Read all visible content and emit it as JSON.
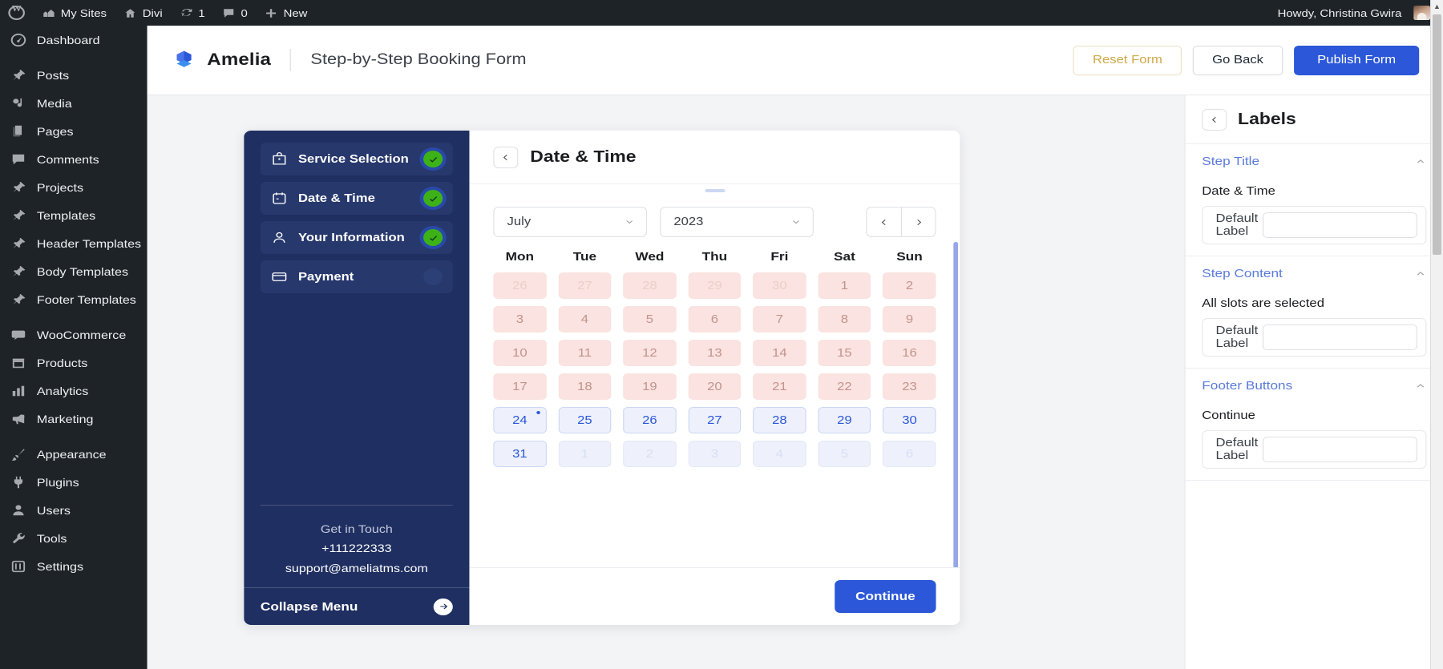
{
  "adminbar": {
    "items": [
      {
        "icon": "wordpress-logo-icon",
        "label": ""
      },
      {
        "icon": "sites-icon",
        "label": "My Sites"
      },
      {
        "icon": "home-icon",
        "label": "Divi"
      },
      {
        "icon": "updates-icon",
        "label": "1"
      },
      {
        "icon": "comment-icon",
        "label": "0"
      },
      {
        "icon": "plus-icon",
        "label": "New"
      }
    ],
    "howdy": "Howdy, Christina Gwira"
  },
  "adminmenu": {
    "items": [
      {
        "label": "Dashboard",
        "icon": "dashboard-icon"
      },
      {
        "label": "Posts",
        "icon": "pin-icon"
      },
      {
        "label": "Media",
        "icon": "media-icon"
      },
      {
        "label": "Pages",
        "icon": "pages-icon"
      },
      {
        "label": "Comments",
        "icon": "comment-icon"
      },
      {
        "label": "Projects",
        "icon": "pin-icon"
      },
      {
        "label": "Templates",
        "icon": "pin-icon"
      },
      {
        "label": "Header Templates",
        "icon": "pin-icon"
      },
      {
        "label": "Body Templates",
        "icon": "pin-icon"
      },
      {
        "label": "Footer Templates",
        "icon": "pin-icon"
      },
      {
        "label": "WooCommerce",
        "icon": "woocommerce-icon"
      },
      {
        "label": "Products",
        "icon": "products-icon"
      },
      {
        "label": "Analytics",
        "icon": "analytics-icon"
      },
      {
        "label": "Marketing",
        "icon": "megaphone-icon"
      },
      {
        "label": "Appearance",
        "icon": "brush-icon"
      },
      {
        "label": "Plugins",
        "icon": "plug-icon"
      },
      {
        "label": "Users",
        "icon": "user-icon"
      },
      {
        "label": "Tools",
        "icon": "wrench-icon"
      },
      {
        "label": "Settings",
        "icon": "settings-icon"
      }
    ]
  },
  "header": {
    "brand": "Amelia",
    "page_title": "Step-by-Step Booking Form",
    "reset_label": "Reset Form",
    "goback_label": "Go Back",
    "publish_label": "Publish Form",
    "accent": "#2b57d8",
    "reset_color": "#cfa847"
  },
  "booking": {
    "steps": [
      {
        "label": "Service Selection",
        "icon": "bag-icon",
        "state": "complete"
      },
      {
        "label": "Date & Time",
        "icon": "calendar-icon",
        "state": "complete"
      },
      {
        "label": "Your Information",
        "icon": "person-icon",
        "state": "complete"
      },
      {
        "label": "Payment",
        "icon": "card-icon",
        "state": "pending"
      }
    ],
    "contact": {
      "title": "Get in Touch",
      "phone": "+111222333",
      "email": "support@ameliatms.com"
    },
    "collapse_label": "Collapse Menu",
    "step_title": "Date & Time",
    "month": "July",
    "year": "2023",
    "weekdays": [
      "Mon",
      "Tue",
      "Wed",
      "Thu",
      "Fri",
      "Sat",
      "Sun"
    ],
    "weeks": [
      [
        {
          "d": "26",
          "state": "busy",
          "outside": true
        },
        {
          "d": "27",
          "state": "busy",
          "outside": true
        },
        {
          "d": "28",
          "state": "busy",
          "outside": true
        },
        {
          "d": "29",
          "state": "busy",
          "outside": true
        },
        {
          "d": "30",
          "state": "busy",
          "outside": true
        },
        {
          "d": "1",
          "state": "busy",
          "outside": false
        },
        {
          "d": "2",
          "state": "busy",
          "outside": false
        }
      ],
      [
        {
          "d": "3",
          "state": "busy",
          "outside": false
        },
        {
          "d": "4",
          "state": "busy",
          "outside": false
        },
        {
          "d": "5",
          "state": "busy",
          "outside": false
        },
        {
          "d": "6",
          "state": "busy",
          "outside": false
        },
        {
          "d": "7",
          "state": "busy",
          "outside": false
        },
        {
          "d": "8",
          "state": "busy",
          "outside": false
        },
        {
          "d": "9",
          "state": "busy",
          "outside": false
        }
      ],
      [
        {
          "d": "10",
          "state": "busy",
          "outside": false
        },
        {
          "d": "11",
          "state": "busy",
          "outside": false
        },
        {
          "d": "12",
          "state": "busy",
          "outside": false
        },
        {
          "d": "13",
          "state": "busy",
          "outside": false
        },
        {
          "d": "14",
          "state": "busy",
          "outside": false
        },
        {
          "d": "15",
          "state": "busy",
          "outside": false
        },
        {
          "d": "16",
          "state": "busy",
          "outside": false
        }
      ],
      [
        {
          "d": "17",
          "state": "busy",
          "outside": false
        },
        {
          "d": "18",
          "state": "busy",
          "outside": false
        },
        {
          "d": "19",
          "state": "busy",
          "outside": false
        },
        {
          "d": "20",
          "state": "busy",
          "outside": false
        },
        {
          "d": "21",
          "state": "busy",
          "outside": false
        },
        {
          "d": "22",
          "state": "busy",
          "outside": false
        },
        {
          "d": "23",
          "state": "busy",
          "outside": false
        }
      ],
      [
        {
          "d": "24",
          "state": "free",
          "outside": false,
          "today": true
        },
        {
          "d": "25",
          "state": "free",
          "outside": false
        },
        {
          "d": "26",
          "state": "free",
          "outside": false
        },
        {
          "d": "27",
          "state": "free",
          "outside": false
        },
        {
          "d": "28",
          "state": "free",
          "outside": false
        },
        {
          "d": "29",
          "state": "free",
          "outside": false
        },
        {
          "d": "30",
          "state": "free",
          "outside": false
        }
      ],
      [
        {
          "d": "31",
          "state": "free",
          "outside": false
        },
        {
          "d": "1",
          "state": "free",
          "outside": true
        },
        {
          "d": "2",
          "state": "free",
          "outside": true
        },
        {
          "d": "3",
          "state": "free",
          "outside": true
        },
        {
          "d": "4",
          "state": "free",
          "outside": true
        },
        {
          "d": "5",
          "state": "free",
          "outside": true
        },
        {
          "d": "6",
          "state": "free",
          "outside": true
        }
      ]
    ],
    "continue_label": "Continue"
  },
  "settings": {
    "title": "Labels",
    "sections": [
      {
        "heading": "Step Title",
        "field_title": "Date & Time",
        "row_label": "Default Label",
        "input_value": ""
      },
      {
        "heading": "Step Content",
        "field_title": "All slots are selected",
        "row_label": "Default Label",
        "input_value": ""
      },
      {
        "heading": "Footer Buttons",
        "field_title": "Continue",
        "row_label": "Default Label",
        "input_value": ""
      }
    ]
  }
}
